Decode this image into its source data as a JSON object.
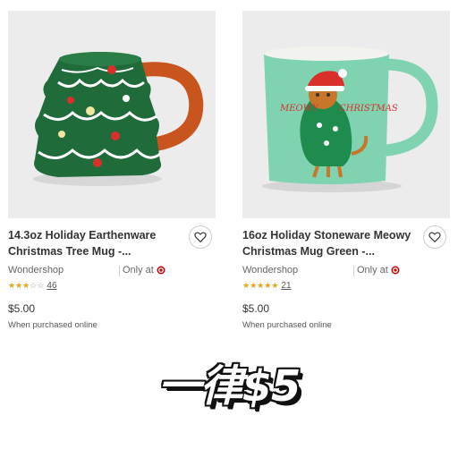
{
  "products": [
    {
      "title_line1": "14.3oz Holiday Earthenware",
      "title_line2": "Christmas Tree Mug -...",
      "brand": "Wondershop",
      "availability": "Only at",
      "rating": 3.5,
      "review_count": "46",
      "price": "$5.00",
      "note": "When purchased online"
    },
    {
      "title_line1": "16oz Holiday Stoneware Meowy",
      "title_line2": "Christmas Mug Green -...",
      "brand": "Wondershop",
      "availability": "Only at",
      "rating": 5,
      "review_count": "21",
      "price": "$5.00",
      "note": "When purchased online",
      "mug_text_left": "MEOWY",
      "mug_text_right": "CHRISTMAS"
    }
  ],
  "promo": "一律$5",
  "colors": {
    "tree_green": "#1f6b3a",
    "mug_mint": "#7fd3b0",
    "target_red": "#cc0000",
    "star_gold": "#e8a317"
  }
}
